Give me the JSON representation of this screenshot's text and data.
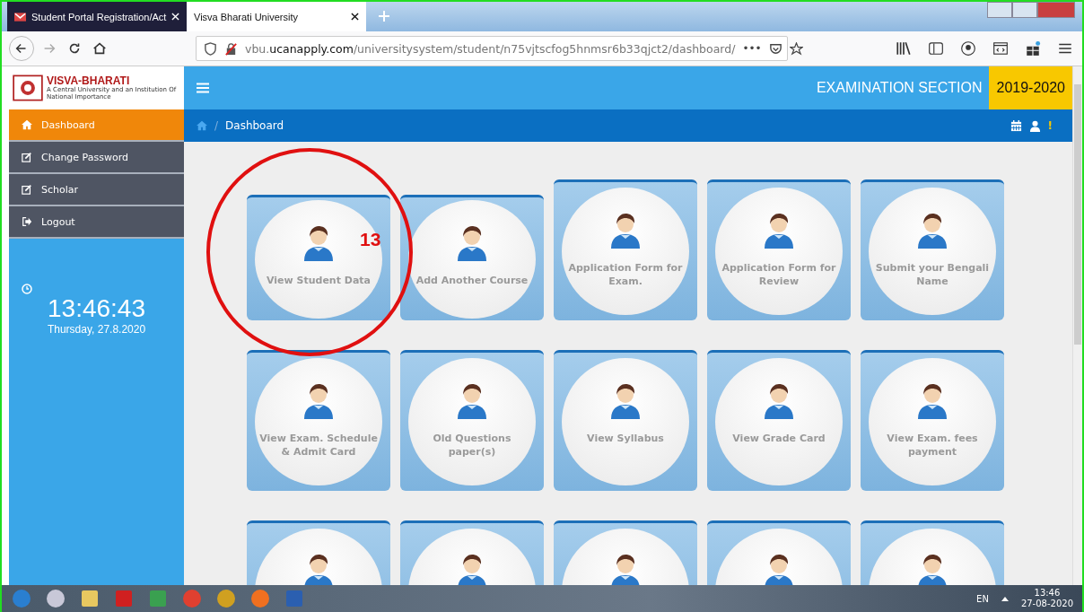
{
  "browser": {
    "tabs": [
      {
        "title": "Student Portal Registration/Act",
        "kind": "mail",
        "selected": false
      },
      {
        "title": "Visva Bharati University",
        "kind": "site",
        "selected": true
      }
    ],
    "url": {
      "prefix": "vbu.",
      "host": "ucanapply.com",
      "path": "/universitysystem/student/n75vjtscfog5hnmsr6b33qjct2/dashboard/"
    },
    "more": "•••"
  },
  "site": {
    "logo_name": "VISVA-BHARATI",
    "logo_tagline": "A Central University and an Institution Of National Importance",
    "section": "EXAMINATION SECTION",
    "session": "2019-2020",
    "sidebar": [
      {
        "label": "Dashboard",
        "kind": "home",
        "selected": true
      },
      {
        "label": "Change Password",
        "kind": "edit",
        "selected": false
      },
      {
        "label": "Scholar",
        "kind": "edit",
        "selected": false
      },
      {
        "label": "Logout",
        "kind": "logout",
        "selected": false
      }
    ],
    "clock": {
      "time": "13:46:43",
      "date": "Thursday, 27.8.2020"
    },
    "breadcrumb_separator": "/",
    "breadcrumb": "Dashboard",
    "alert": "!",
    "tiles": [
      {
        "kind": "full",
        "label": "View Student Data"
      },
      {
        "kind": "full",
        "label": "Add Another Course"
      },
      {
        "kind": "full",
        "label": "Application Form for Exam."
      },
      {
        "kind": "full",
        "label": "Application Form for Review"
      },
      {
        "kind": "full",
        "label": "Submit your Bengali Name"
      },
      {
        "kind": "full",
        "label": "View Exam. Schedule & Admit Card"
      },
      {
        "kind": "full",
        "label": "Old Questions paper(s)"
      },
      {
        "kind": "full",
        "label": "View Syllabus"
      },
      {
        "kind": "full",
        "label": "View Grade Card"
      },
      {
        "kind": "full",
        "label": "View Exam. fees payment"
      },
      {
        "kind": "partial"
      },
      {
        "kind": "partial"
      },
      {
        "kind": "partial"
      },
      {
        "kind": "partial"
      },
      {
        "kind": "partial"
      }
    ],
    "annotation": "13"
  },
  "taskbar": {
    "language": "EN",
    "time": "13:46",
    "date": "27-08-2020"
  }
}
